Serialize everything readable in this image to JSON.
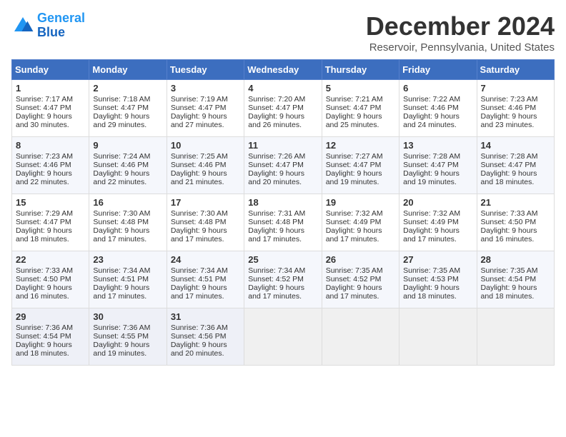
{
  "header": {
    "logo_line1": "General",
    "logo_line2": "Blue",
    "month_title": "December 2024",
    "subtitle": "Reservoir, Pennsylvania, United States"
  },
  "days_of_week": [
    "Sunday",
    "Monday",
    "Tuesday",
    "Wednesday",
    "Thursday",
    "Friday",
    "Saturday"
  ],
  "weeks": [
    [
      {
        "day": 1,
        "lines": [
          "Sunrise: 7:17 AM",
          "Sunset: 4:47 PM",
          "Daylight: 9 hours",
          "and 30 minutes."
        ]
      },
      {
        "day": 2,
        "lines": [
          "Sunrise: 7:18 AM",
          "Sunset: 4:47 PM",
          "Daylight: 9 hours",
          "and 29 minutes."
        ]
      },
      {
        "day": 3,
        "lines": [
          "Sunrise: 7:19 AM",
          "Sunset: 4:47 PM",
          "Daylight: 9 hours",
          "and 27 minutes."
        ]
      },
      {
        "day": 4,
        "lines": [
          "Sunrise: 7:20 AM",
          "Sunset: 4:47 PM",
          "Daylight: 9 hours",
          "and 26 minutes."
        ]
      },
      {
        "day": 5,
        "lines": [
          "Sunrise: 7:21 AM",
          "Sunset: 4:47 PM",
          "Daylight: 9 hours",
          "and 25 minutes."
        ]
      },
      {
        "day": 6,
        "lines": [
          "Sunrise: 7:22 AM",
          "Sunset: 4:46 PM",
          "Daylight: 9 hours",
          "and 24 minutes."
        ]
      },
      {
        "day": 7,
        "lines": [
          "Sunrise: 7:23 AM",
          "Sunset: 4:46 PM",
          "Daylight: 9 hours",
          "and 23 minutes."
        ]
      }
    ],
    [
      {
        "day": 8,
        "lines": [
          "Sunrise: 7:23 AM",
          "Sunset: 4:46 PM",
          "Daylight: 9 hours",
          "and 22 minutes."
        ]
      },
      {
        "day": 9,
        "lines": [
          "Sunrise: 7:24 AM",
          "Sunset: 4:46 PM",
          "Daylight: 9 hours",
          "and 22 minutes."
        ]
      },
      {
        "day": 10,
        "lines": [
          "Sunrise: 7:25 AM",
          "Sunset: 4:46 PM",
          "Daylight: 9 hours",
          "and 21 minutes."
        ]
      },
      {
        "day": 11,
        "lines": [
          "Sunrise: 7:26 AM",
          "Sunset: 4:47 PM",
          "Daylight: 9 hours",
          "and 20 minutes."
        ]
      },
      {
        "day": 12,
        "lines": [
          "Sunrise: 7:27 AM",
          "Sunset: 4:47 PM",
          "Daylight: 9 hours",
          "and 19 minutes."
        ]
      },
      {
        "day": 13,
        "lines": [
          "Sunrise: 7:28 AM",
          "Sunset: 4:47 PM",
          "Daylight: 9 hours",
          "and 19 minutes."
        ]
      },
      {
        "day": 14,
        "lines": [
          "Sunrise: 7:28 AM",
          "Sunset: 4:47 PM",
          "Daylight: 9 hours",
          "and 18 minutes."
        ]
      }
    ],
    [
      {
        "day": 15,
        "lines": [
          "Sunrise: 7:29 AM",
          "Sunset: 4:47 PM",
          "Daylight: 9 hours",
          "and 18 minutes."
        ]
      },
      {
        "day": 16,
        "lines": [
          "Sunrise: 7:30 AM",
          "Sunset: 4:48 PM",
          "Daylight: 9 hours",
          "and 17 minutes."
        ]
      },
      {
        "day": 17,
        "lines": [
          "Sunrise: 7:30 AM",
          "Sunset: 4:48 PM",
          "Daylight: 9 hours",
          "and 17 minutes."
        ]
      },
      {
        "day": 18,
        "lines": [
          "Sunrise: 7:31 AM",
          "Sunset: 4:48 PM",
          "Daylight: 9 hours",
          "and 17 minutes."
        ]
      },
      {
        "day": 19,
        "lines": [
          "Sunrise: 7:32 AM",
          "Sunset: 4:49 PM",
          "Daylight: 9 hours",
          "and 17 minutes."
        ]
      },
      {
        "day": 20,
        "lines": [
          "Sunrise: 7:32 AM",
          "Sunset: 4:49 PM",
          "Daylight: 9 hours",
          "and 17 minutes."
        ]
      },
      {
        "day": 21,
        "lines": [
          "Sunrise: 7:33 AM",
          "Sunset: 4:50 PM",
          "Daylight: 9 hours",
          "and 16 minutes."
        ]
      }
    ],
    [
      {
        "day": 22,
        "lines": [
          "Sunrise: 7:33 AM",
          "Sunset: 4:50 PM",
          "Daylight: 9 hours",
          "and 16 minutes."
        ]
      },
      {
        "day": 23,
        "lines": [
          "Sunrise: 7:34 AM",
          "Sunset: 4:51 PM",
          "Daylight: 9 hours",
          "and 17 minutes."
        ]
      },
      {
        "day": 24,
        "lines": [
          "Sunrise: 7:34 AM",
          "Sunset: 4:51 PM",
          "Daylight: 9 hours",
          "and 17 minutes."
        ]
      },
      {
        "day": 25,
        "lines": [
          "Sunrise: 7:34 AM",
          "Sunset: 4:52 PM",
          "Daylight: 9 hours",
          "and 17 minutes."
        ]
      },
      {
        "day": 26,
        "lines": [
          "Sunrise: 7:35 AM",
          "Sunset: 4:52 PM",
          "Daylight: 9 hours",
          "and 17 minutes."
        ]
      },
      {
        "day": 27,
        "lines": [
          "Sunrise: 7:35 AM",
          "Sunset: 4:53 PM",
          "Daylight: 9 hours",
          "and 18 minutes."
        ]
      },
      {
        "day": 28,
        "lines": [
          "Sunrise: 7:35 AM",
          "Sunset: 4:54 PM",
          "Daylight: 9 hours",
          "and 18 minutes."
        ]
      }
    ],
    [
      {
        "day": 29,
        "lines": [
          "Sunrise: 7:36 AM",
          "Sunset: 4:54 PM",
          "Daylight: 9 hours",
          "and 18 minutes."
        ]
      },
      {
        "day": 30,
        "lines": [
          "Sunrise: 7:36 AM",
          "Sunset: 4:55 PM",
          "Daylight: 9 hours",
          "and 19 minutes."
        ]
      },
      {
        "day": 31,
        "lines": [
          "Sunrise: 7:36 AM",
          "Sunset: 4:56 PM",
          "Daylight: 9 hours",
          "and 20 minutes."
        ]
      },
      null,
      null,
      null,
      null
    ]
  ]
}
